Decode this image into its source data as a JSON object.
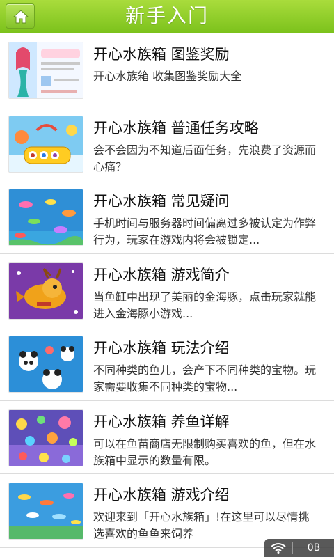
{
  "header": {
    "title": "新手入门",
    "home_icon": "home-icon"
  },
  "items": [
    {
      "title": "开心水族箱 图鉴奖励",
      "desc": "开心水族箱 收集图鉴奖励大全"
    },
    {
      "title": "开心水族箱 普通任务攻略",
      "desc": "会不会因为不知道后面任务，先浪费了资源而心痛？"
    },
    {
      "title": "开心水族箱 常见疑问",
      "desc": "手机时间与服务器时间偏离过多被认定为作弊行为，玩家在游戏内将会被锁定..."
    },
    {
      "title": "开心水族箱 游戏简介",
      "desc": "当鱼缸中出现了美丽的金海豚，点击玩家就能进入金海豚小游戏..."
    },
    {
      "title": "开心水族箱 玩法介绍",
      "desc": "不同种类的鱼儿，会产下不同种类的宝物。玩家需要收集不同种类的宝物..."
    },
    {
      "title": "开心水族箱 养鱼详解",
      "desc": "可以在鱼苗商店无限制购买喜欢的鱼，但在水族箱中显示的数量有限。"
    },
    {
      "title": "开心水族箱 游戏介绍",
      "desc": "欢迎来到「开心水族箱」!在这里可以尽情挑选喜欢的鱼鱼来饲养"
    }
  ],
  "status": {
    "traffic": "0B",
    "wifi_icon": "wifi-icon"
  },
  "colors": {
    "header": "#8fcd2a",
    "divider": "#dcdcdc"
  }
}
